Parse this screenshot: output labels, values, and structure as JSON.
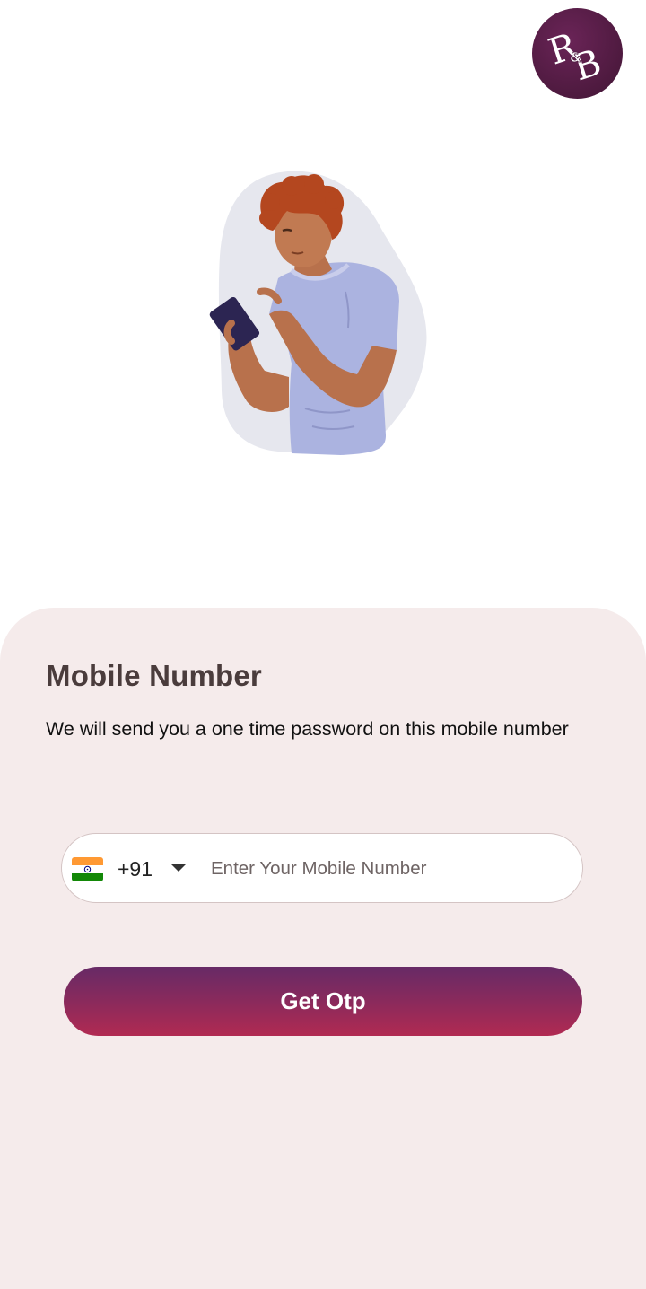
{
  "header": {
    "logo_text": "R&B",
    "logo_color": "#4e1a3f"
  },
  "illustration": {
    "icon": "person-using-phone-illustration"
  },
  "login": {
    "title": "Mobile Number",
    "subtitle": "We will send you a one time password on this mobile number",
    "country": {
      "flag_icon": "india-flag-icon",
      "dial_code": "+91"
    },
    "phone_input": {
      "value": "",
      "placeholder": "Enter Your Mobile Number"
    },
    "submit_label": "Get Otp"
  },
  "colors": {
    "panel_background": "#f5ebeb",
    "button_gradient_top": "#672a66",
    "button_gradient_bottom": "#b12a52",
    "title_color": "#4a3c3c"
  }
}
